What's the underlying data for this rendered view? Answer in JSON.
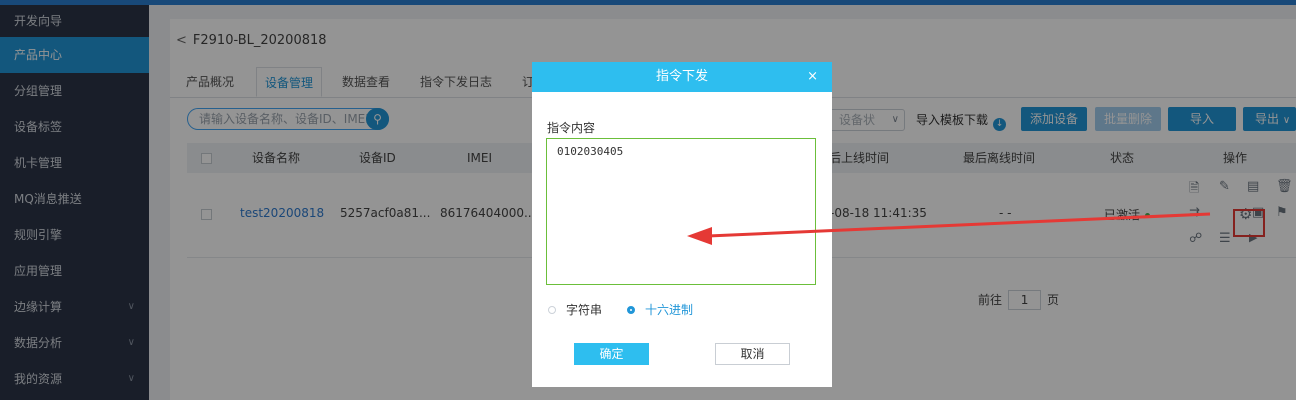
{
  "sidebar": {
    "items": [
      {
        "label": "开发向导"
      },
      {
        "label": "产品中心"
      },
      {
        "label": "分组管理"
      },
      {
        "label": "设备标签"
      },
      {
        "label": "机卡管理"
      },
      {
        "label": "MQ消息推送"
      },
      {
        "label": "规则引擎"
      },
      {
        "label": "应用管理"
      },
      {
        "label": "边缘计算"
      },
      {
        "label": "数据分析"
      },
      {
        "label": "我的资源"
      }
    ],
    "active_index": 1
  },
  "header": {
    "back_title": "F2910-BL_20200818"
  },
  "tabs": [
    {
      "label": "产品概况"
    },
    {
      "label": "设备管理"
    },
    {
      "label": "数据查看"
    },
    {
      "label": "指令下发日志"
    },
    {
      "label": "订"
    }
  ],
  "toolbar": {
    "search_placeholder": "请输入设备名称、设备ID、IMEI",
    "status_select": "设备状",
    "template_download": "导入模板下载",
    "add_device": "添加设备",
    "batch_delete": "批量删除",
    "import": "导入",
    "export": "导出"
  },
  "table": {
    "headers": {
      "name": "设备名称",
      "id": "设备ID",
      "imei": "IMEI",
      "last_online": "后上线时间",
      "last_offline": "最后离线时间",
      "status": "状态",
      "ops": "操作"
    },
    "row": {
      "name": "test20200818",
      "id": "5257acf0a81...",
      "imei": "86176404000...",
      "last_online": "-08-18 11:41:35",
      "last_offline": "- -",
      "status": "已激活"
    }
  },
  "pager": {
    "prefix": "前往",
    "page": "1",
    "suffix": "页"
  },
  "modal": {
    "title": "指令下发",
    "close": "×",
    "content_label": "指令内容",
    "content_value": "0102030405",
    "radio_string": "字符串",
    "radio_hex": "十六进制",
    "selected_format": "hex",
    "confirm": "确定",
    "cancel": "取消"
  },
  "colors": {
    "sidebar_bg": "#2b3547",
    "accent": "#2196d8",
    "modal_header": "#2ebeef",
    "annotation_red": "#e53935"
  }
}
